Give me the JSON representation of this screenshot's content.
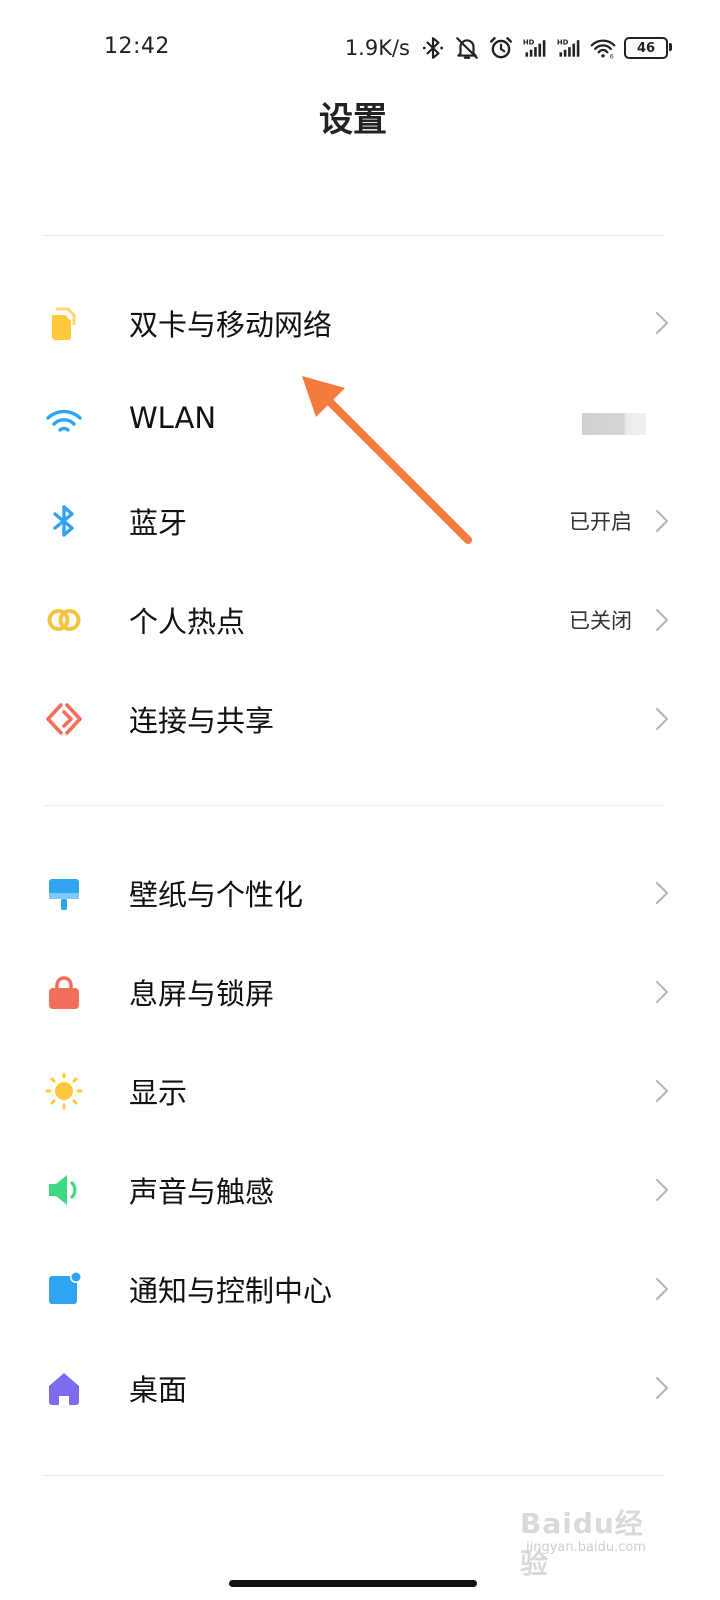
{
  "status_bar": {
    "time": "12:42",
    "net_speed": "1.9K/s",
    "battery": "46",
    "icons": [
      "bluetooth-icon",
      "mute-icon",
      "alarm-icon",
      "hd-signal-icon",
      "hd-signal-icon",
      "wifi-icon",
      "battery-icon"
    ]
  },
  "header": {
    "title": "设置"
  },
  "groups": [
    {
      "items": [
        {
          "label": "双卡与移动网络",
          "status": "",
          "icon": "sim-card-icon",
          "color": "#FFC83D"
        },
        {
          "label": "WLAN",
          "status": "",
          "icon": "wifi-icon",
          "color": "#2FA4F0"
        },
        {
          "label": "蓝牙",
          "status": "已开启",
          "icon": "bluetooth-icon",
          "color": "#2FA4F0"
        },
        {
          "label": "个人热点",
          "status": "已关闭",
          "icon": "hotspot-icon",
          "color": "#F5C443"
        },
        {
          "label": "连接与共享",
          "status": "",
          "icon": "connection-share-icon",
          "color": "#F26F5B"
        }
      ]
    },
    {
      "items": [
        {
          "label": "壁纸与个性化",
          "status": "",
          "icon": "wallpaper-brush-icon",
          "color": "#2FA4F0"
        },
        {
          "label": "息屏与锁屏",
          "status": "",
          "icon": "lock-icon",
          "color": "#F26F5B"
        },
        {
          "label": "显示",
          "status": "",
          "icon": "sun-icon",
          "color": "#FFC83D"
        },
        {
          "label": "声音与触感",
          "status": "",
          "icon": "speaker-icon",
          "color": "#3ED97F"
        },
        {
          "label": "通知与控制中心",
          "status": "",
          "icon": "notification-icon",
          "color": "#2FA4F0"
        },
        {
          "label": "桌面",
          "status": "",
          "icon": "home-icon",
          "color": "#7B6CF0"
        }
      ]
    }
  ],
  "annotation": {
    "color": "#F47A3D"
  },
  "watermark": {
    "text": "Baidu经验",
    "sub": "jingyan.baidu.com"
  }
}
